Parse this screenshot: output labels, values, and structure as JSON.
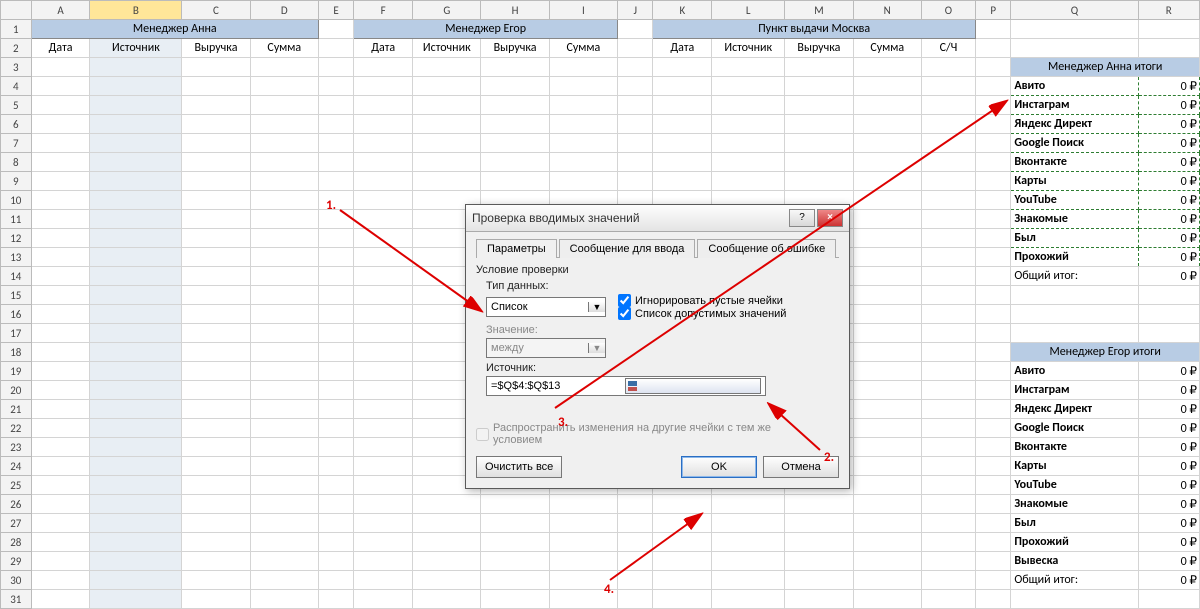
{
  "columns": [
    "A",
    "B",
    "C",
    "D",
    "E",
    "F",
    "G",
    "H",
    "I",
    "J",
    "K",
    "L",
    "M",
    "N",
    "O",
    "P",
    "Q",
    "R"
  ],
  "row_count": 31,
  "sections": {
    "anna_title": "Менеджер Анна",
    "egor_title": "Менеджер Егор",
    "moscow_title": "Пункт выдачи Москва",
    "headers_date": "Дата",
    "headers_source": "Источник",
    "headers_revenue": "Выручка",
    "headers_sum": "Сумма",
    "headers_sch": "С/Ч"
  },
  "summary_anna": {
    "title": "Менеджер Анна итоги",
    "rows": [
      "Авито",
      "Инстаграм",
      "Яндекс Директ",
      "Google Поиск",
      "Вконтакте",
      "Карты",
      "YouTube",
      "Знакомые",
      "Был",
      "Прохожий"
    ],
    "total_label": "Общий итог:",
    "value": "0 ₽"
  },
  "summary_egor": {
    "title": "Менеджер Егор итоги",
    "rows": [
      "Авито",
      "Инстаграм",
      "Яндекс Директ",
      "Google Поиск",
      "Вконтакте",
      "Карты",
      "YouTube",
      "Знакомые",
      "Был",
      "Прохожий",
      "Вывеска"
    ],
    "total_label": "Общий итог:",
    "value": "0 ₽"
  },
  "dialog": {
    "title": "Проверка вводимых значений",
    "help": "?",
    "close": "×",
    "tab1": "Параметры",
    "tab2": "Сообщение для ввода",
    "tab3": "Сообщение об ошибке",
    "condition_label": "Условие проверки",
    "type_label": "Тип данных:",
    "type_value": "Список",
    "ignore_empty": "Игнорировать пустые ячейки",
    "dropdown_chk": "Список допустимых значений",
    "value_label": "Значение:",
    "value_value": "между",
    "source_label": "Источник:",
    "source_value": "=$Q$4:$Q$13",
    "propagate": "Распространить изменения на другие ячейки с тем же условием",
    "clear_all": "Очистить все",
    "ok": "OK",
    "cancel": "Отмена"
  },
  "annotations": {
    "n1": "1.",
    "n2": "2.",
    "n3": "3.",
    "n4": "4."
  }
}
